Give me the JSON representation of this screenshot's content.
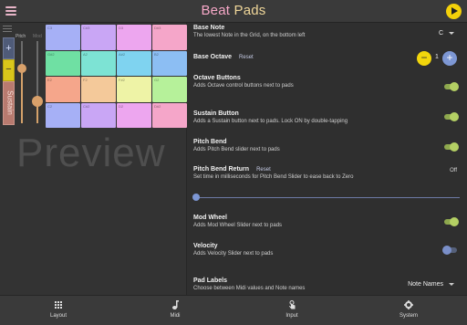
{
  "header": {
    "title_part1": "Beat",
    "title_part2": "Pads"
  },
  "preview": {
    "pitch_label": "Pitch",
    "mod_label": "Mod",
    "octave_plus": "+",
    "octave_minus": "−",
    "sustain_label": "Sustain",
    "watermark": "Preview",
    "pads": [
      {
        "label": "C3",
        "color": "#a6b0f6"
      },
      {
        "label": "C#3",
        "color": "#c9a6f5"
      },
      {
        "label": "D3",
        "color": "#eda6ef"
      },
      {
        "label": "D#3",
        "color": "#f5a6c9"
      },
      {
        "label": "G#2",
        "color": "#6fe0a3"
      },
      {
        "label": "A2",
        "color": "#7de3d4"
      },
      {
        "label": "A#2",
        "color": "#7fd3f0"
      },
      {
        "label": "B2",
        "color": "#8cbef3"
      },
      {
        "label": "E2",
        "color": "#f5a68b"
      },
      {
        "label": "F2",
        "color": "#f4c99a"
      },
      {
        "label": "F#2",
        "color": "#eef3a6"
      },
      {
        "label": "G2",
        "color": "#b6f19a"
      },
      {
        "label": "C2",
        "color": "#a6b0f6"
      },
      {
        "label": "C#2",
        "color": "#c9a6f5"
      },
      {
        "label": "D2",
        "color": "#eda6ef"
      },
      {
        "label": "D#2",
        "color": "#f5a6c9"
      }
    ]
  },
  "settings": {
    "base_note": {
      "label": "Base Note",
      "desc": "The lowest Note in the Grid, on the bottom left",
      "value": "C"
    },
    "base_octave": {
      "label": "Base Octave",
      "reset": "Reset",
      "value": "1",
      "minus": "−",
      "plus": "+"
    },
    "octave_buttons": {
      "label": "Octave Buttons",
      "desc": "Adds Octave control buttons next to pads",
      "on": true
    },
    "sustain_button": {
      "label": "Sustain Button",
      "desc": "Adds a Sustain button next to pads. Lock ON by double-tapping",
      "on": true
    },
    "pitch_bend": {
      "label": "Pitch Bend",
      "desc": "Adds Pitch Bend slider next to pads",
      "on": true
    },
    "pitch_bend_return": {
      "label": "Pitch Bend Return",
      "reset": "Reset",
      "desc": "Set time in milliseconds for Pitch Bend Slider to ease back to Zero",
      "value": "Off",
      "slider": 0
    },
    "mod_wheel": {
      "label": "Mod Wheel",
      "desc": "Adds Mod Wheel Slider next to pads",
      "on": true
    },
    "velocity": {
      "label": "Velocity",
      "desc": "Adds Velocity Slider next to pads",
      "on": false
    },
    "pad_labels": {
      "label": "Pad Labels",
      "desc": "Choose between Midi values and Note names",
      "value": "Note Names"
    }
  },
  "nav": [
    {
      "label": "Layout",
      "icon": "grid-icon"
    },
    {
      "label": "Midi",
      "icon": "music-note-icon"
    },
    {
      "label": "Input",
      "icon": "touch-icon"
    },
    {
      "label": "System",
      "icon": "gear-icon"
    }
  ],
  "colors": {
    "accent_yellow": "#f4d10a",
    "accent_blue": "#7d97d4",
    "toggle_on": "#b4d064",
    "title_pink": "#f7a8c8",
    "title_gold": "#f0d79a"
  }
}
